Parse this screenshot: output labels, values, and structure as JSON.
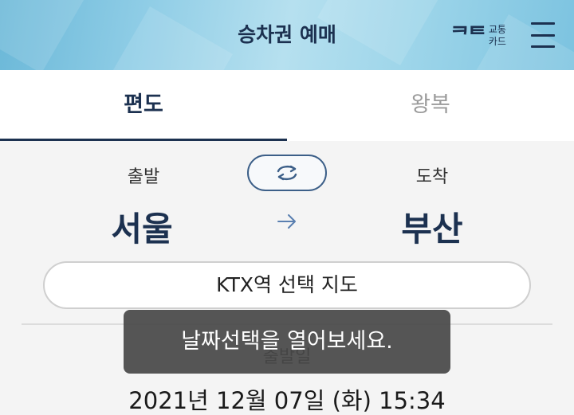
{
  "header": {
    "title": "승차권 예매",
    "card_logo": "ᄏᄐ",
    "card_line1": "교통",
    "card_line2": "카드",
    "menu_icon": "hamburger-menu-icon",
    "colors": {
      "dark_navy": "#1c3150",
      "sky": "#8fcde6"
    }
  },
  "tabs": [
    {
      "label": "편도",
      "active": true
    },
    {
      "label": "왕복",
      "active": false
    }
  ],
  "route": {
    "departure_label": "출발",
    "departure_station": "서울",
    "arrival_label": "도착",
    "arrival_station": "부산",
    "swap_icon": "swap-arrows-icon",
    "direction_icon": "arrow-right-icon"
  },
  "map_button": {
    "label": "KTX역 선택 지도"
  },
  "datetime": {
    "label": "출발일",
    "value": "2021년 12월 07일 (화) 15:34"
  },
  "toast": {
    "message": "날짜선택을 열어보세요."
  }
}
